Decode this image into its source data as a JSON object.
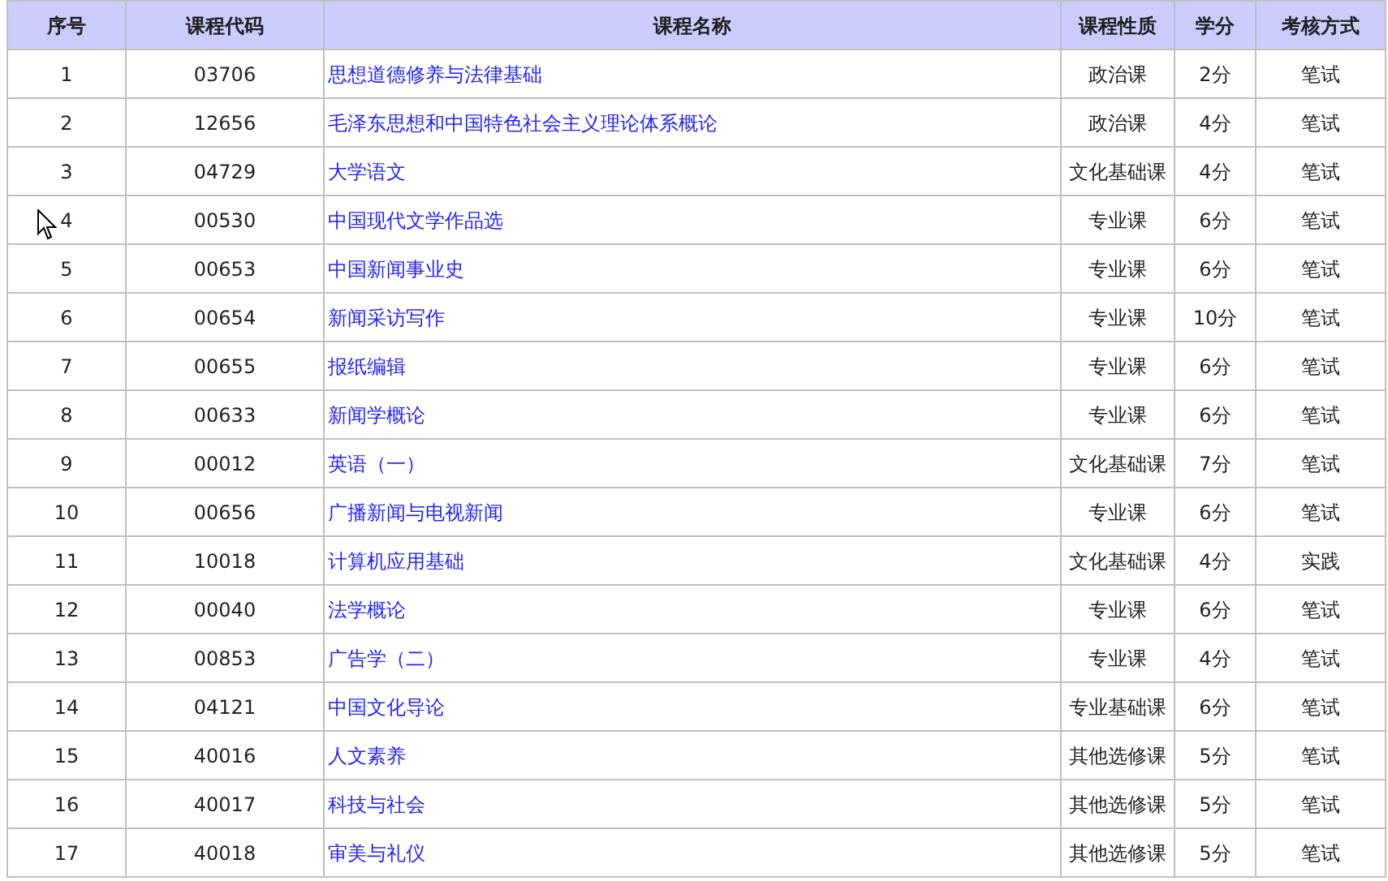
{
  "table": {
    "columns": [
      "序号",
      "课程代码",
      "课程名称",
      "课程性质",
      "学分",
      "考核方式"
    ],
    "rows": [
      [
        "1",
        "03706",
        "思想道德修养与法律基础",
        "政治课",
        "2分",
        "笔试"
      ],
      [
        "2",
        "12656",
        "毛泽东思想和中国特色社会主义理论体系概论",
        "政治课",
        "4分",
        "笔试"
      ],
      [
        "3",
        "04729",
        "大学语文",
        "文化基础课",
        "4分",
        "笔试"
      ],
      [
        "4",
        "00530",
        "中国现代文学作品选",
        "专业课",
        "6分",
        "笔试"
      ],
      [
        "5",
        "00653",
        "中国新闻事业史",
        "专业课",
        "6分",
        "笔试"
      ],
      [
        "6",
        "00654",
        "新闻采访写作",
        "专业课",
        "10分",
        "笔试"
      ],
      [
        "7",
        "00655",
        "报纸编辑",
        "专业课",
        "6分",
        "笔试"
      ],
      [
        "8",
        "00633",
        "新闻学概论",
        "专业课",
        "6分",
        "笔试"
      ],
      [
        "9",
        "00012",
        "英语（一）",
        "文化基础课",
        "7分",
        "笔试"
      ],
      [
        "10",
        "00656",
        "广播新闻与电视新闻",
        "专业课",
        "6分",
        "笔试"
      ],
      [
        "11",
        "10018",
        "计算机应用基础",
        "文化基础课",
        "4分",
        "实践"
      ],
      [
        "12",
        "00040",
        "法学概论",
        "专业课",
        "6分",
        "笔试"
      ],
      [
        "13",
        "00853",
        "广告学（二）",
        "专业课",
        "4分",
        "笔试"
      ],
      [
        "14",
        "04121",
        "中国文化导论",
        "专业基础课",
        "6分",
        "笔试"
      ],
      [
        "15",
        "40016",
        "人文素养",
        "其他选修课",
        "5分",
        "笔试"
      ],
      [
        "16",
        "40017",
        "科技与社会",
        "其他选修课",
        "5分",
        "笔试"
      ],
      [
        "17",
        "40018",
        "审美与礼仪",
        "其他选修课",
        "5分",
        "笔试"
      ]
    ]
  }
}
